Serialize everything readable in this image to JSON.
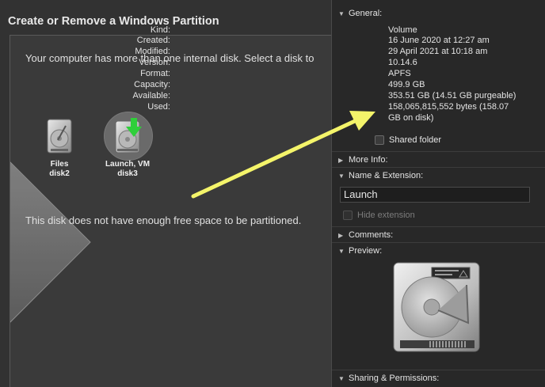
{
  "bootcamp": {
    "title": "Create or Remove a Windows Partition",
    "message": "Your computer has more than one internal disk. Select a disk to",
    "message_bottom": "This disk does not have enough free space to be partitioned.",
    "disks": [
      {
        "name": "Files",
        "id": "disk2"
      },
      {
        "name": "Launch, VM",
        "id": "disk3",
        "selected": true
      }
    ]
  },
  "info": {
    "general_label": "General:",
    "general": {
      "kind_k": "Kind:",
      "kind_v": "Volume",
      "created_k": "Created:",
      "created_v": "16 June 2020 at 12:27 am",
      "modified_k": "Modified:",
      "modified_v": "29 April 2021 at 10:18 am",
      "version_k": "Version:",
      "version_v": "10.14.6",
      "format_k": "Format:",
      "format_v": "APFS",
      "capacity_k": "Capacity:",
      "capacity_v": "499.9 GB",
      "available_k": "Available:",
      "available_v": "353.51 GB (14.51 GB purgeable)",
      "used_k": "Used:",
      "used_v1": "158,065,815,552 bytes (158.07",
      "used_v2": "GB on disk)"
    },
    "shared_folder": "Shared folder",
    "more_info_label": "More Info:",
    "name_ext_label": "Name & Extension:",
    "name_value": "Launch",
    "hide_extension": "Hide extension",
    "comments_label": "Comments:",
    "preview_label": "Preview:",
    "sharing_label": "Sharing & Permissions:"
  },
  "colors": {
    "arrow": "#f4f46a",
    "download_arrow": "#2fcf3a",
    "background": "#323232",
    "info_background": "#282828"
  },
  "icons": [
    "hard-disk-icon",
    "download-arrow-icon",
    "disclosure-triangle-icon",
    "yellow-arrow-annotation"
  ]
}
